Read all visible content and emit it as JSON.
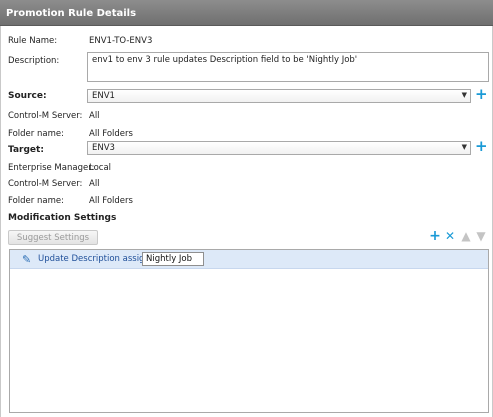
{
  "header": {
    "title": "Promotion Rule Details"
  },
  "rule": {
    "name_label": "Rule Name:",
    "name_value": "ENV1-TO-ENV3",
    "description_label": "Description:",
    "description_value": "env1 to env 3 rule updates Description field to be 'Nightly Job'"
  },
  "source": {
    "label": "Source:",
    "selected": "ENV1",
    "server_label": "Control-M Server:",
    "server_value": "All",
    "folder_label": "Folder name:",
    "folder_value": "All Folders"
  },
  "target": {
    "label": "Target:",
    "selected": "ENV3",
    "em_label": "Enterprise Manager:",
    "em_value": "Local",
    "server_label": "Control-M Server:",
    "server_value": "All",
    "folder_label": "Folder name:",
    "folder_value": "All Folders"
  },
  "modification": {
    "title": "Modification Settings",
    "suggest_label": "Suggest Settings",
    "row": {
      "words": [
        "Update",
        "Description",
        "assign"
      ],
      "value": "Nightly Job"
    }
  },
  "icons": {
    "add": "plus-icon",
    "delete": "x-icon",
    "up": "arrow-up-icon",
    "down": "arrow-down-icon",
    "edit": "pencil-icon"
  },
  "colors": {
    "accent": "#1a9ad6",
    "header": "#7d7d7d",
    "row_highlight": "#dde9f8"
  }
}
